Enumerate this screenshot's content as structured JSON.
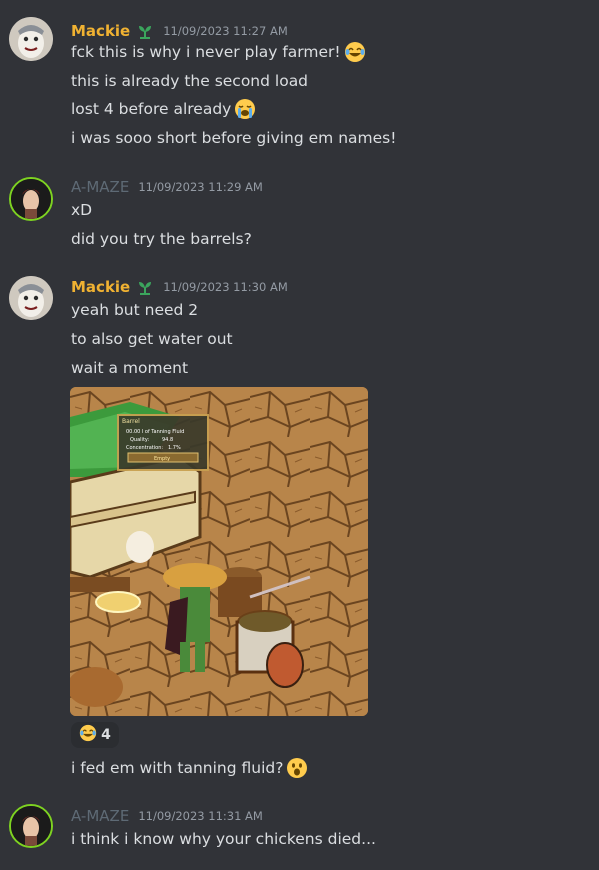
{
  "messages": [
    {
      "username": "Mackie",
      "timestamp": "11/09/2023 11:27 AM",
      "lines": [
        "fck this is why i never play farmer!",
        "this is already the second load",
        "lost 4 before already",
        "i was sooo short before giving em names!"
      ]
    },
    {
      "username": "A-MAZE",
      "timestamp": "11/09/2023 11:29 AM",
      "lines": [
        "xD",
        "did you try the barrels?"
      ]
    },
    {
      "username": "Mackie",
      "timestamp": "11/09/2023 11:30 AM",
      "lines": [
        "yeah but need 2",
        "to also get water out",
        "wait a moment"
      ]
    },
    {
      "lines": [
        "i fed em with tanning fluid?"
      ]
    },
    {
      "username": "A-MAZE",
      "timestamp": "11/09/2023 11:31 AM",
      "lines": [
        "i think i know why your chickens died..."
      ]
    }
  ],
  "reaction": {
    "emoji": "joy-icon",
    "count": "4"
  },
  "game_image": {
    "tooltip_title": "Barrel",
    "tooltip_line1": "00.00 l of Tanning Fluid",
    "tooltip_quality": "Quality:",
    "tooltip_quality_value": "94.8",
    "tooltip_concentration": "Concentration:",
    "tooltip_concentration_value": "1.7%",
    "tooltip_button": "Empty"
  },
  "colors": {
    "background": "#313338",
    "mackie_name": "#f0b232",
    "amaze_name": "#5e6a75",
    "timestamp": "#949ba4",
    "text": "#dbdee1"
  }
}
